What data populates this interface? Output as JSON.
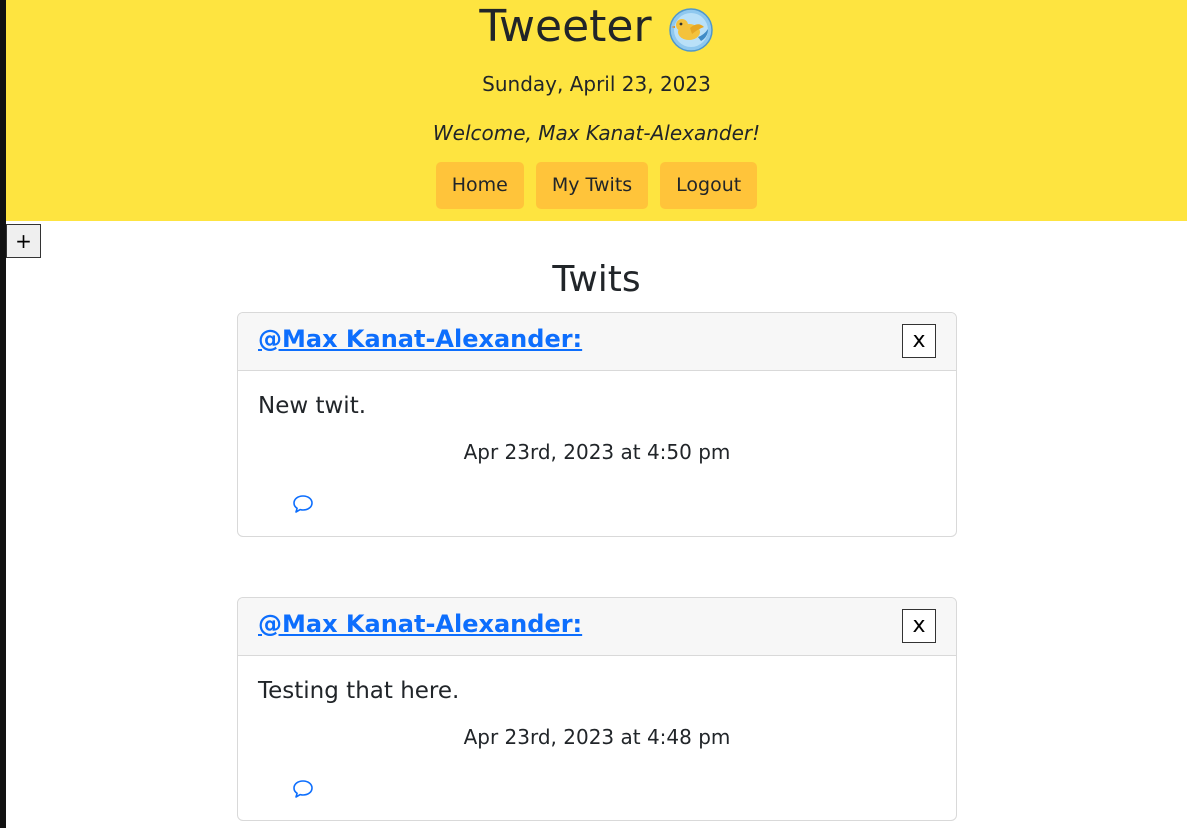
{
  "header": {
    "brand_title": "Tweeter",
    "logo_icon": "bird-globe-icon",
    "date": "Sunday, April 23, 2023",
    "welcome": "Welcome, Max Kanat-Alexander!",
    "nav": [
      "Home",
      "My Twits",
      "Logout"
    ]
  },
  "add_button": "+",
  "section_title": "Twits",
  "twits": [
    {
      "author": "@Max Kanat-Alexander:",
      "delete_label": "x",
      "text": "New twit.",
      "time": "Apr 23rd, 2023 at 4:50 pm",
      "reply_icon": "speech-bubble-icon"
    },
    {
      "author": "@Max Kanat-Alexander:",
      "delete_label": "x",
      "text": "Testing that here.",
      "time": "Apr 23rd, 2023 at 4:48 pm",
      "reply_icon": "speech-bubble-icon"
    }
  ],
  "colors": {
    "banner": "#fee440",
    "nav_button": "#ffc43a",
    "link": "#0d6efd",
    "card_header": "#f7f7f7"
  }
}
